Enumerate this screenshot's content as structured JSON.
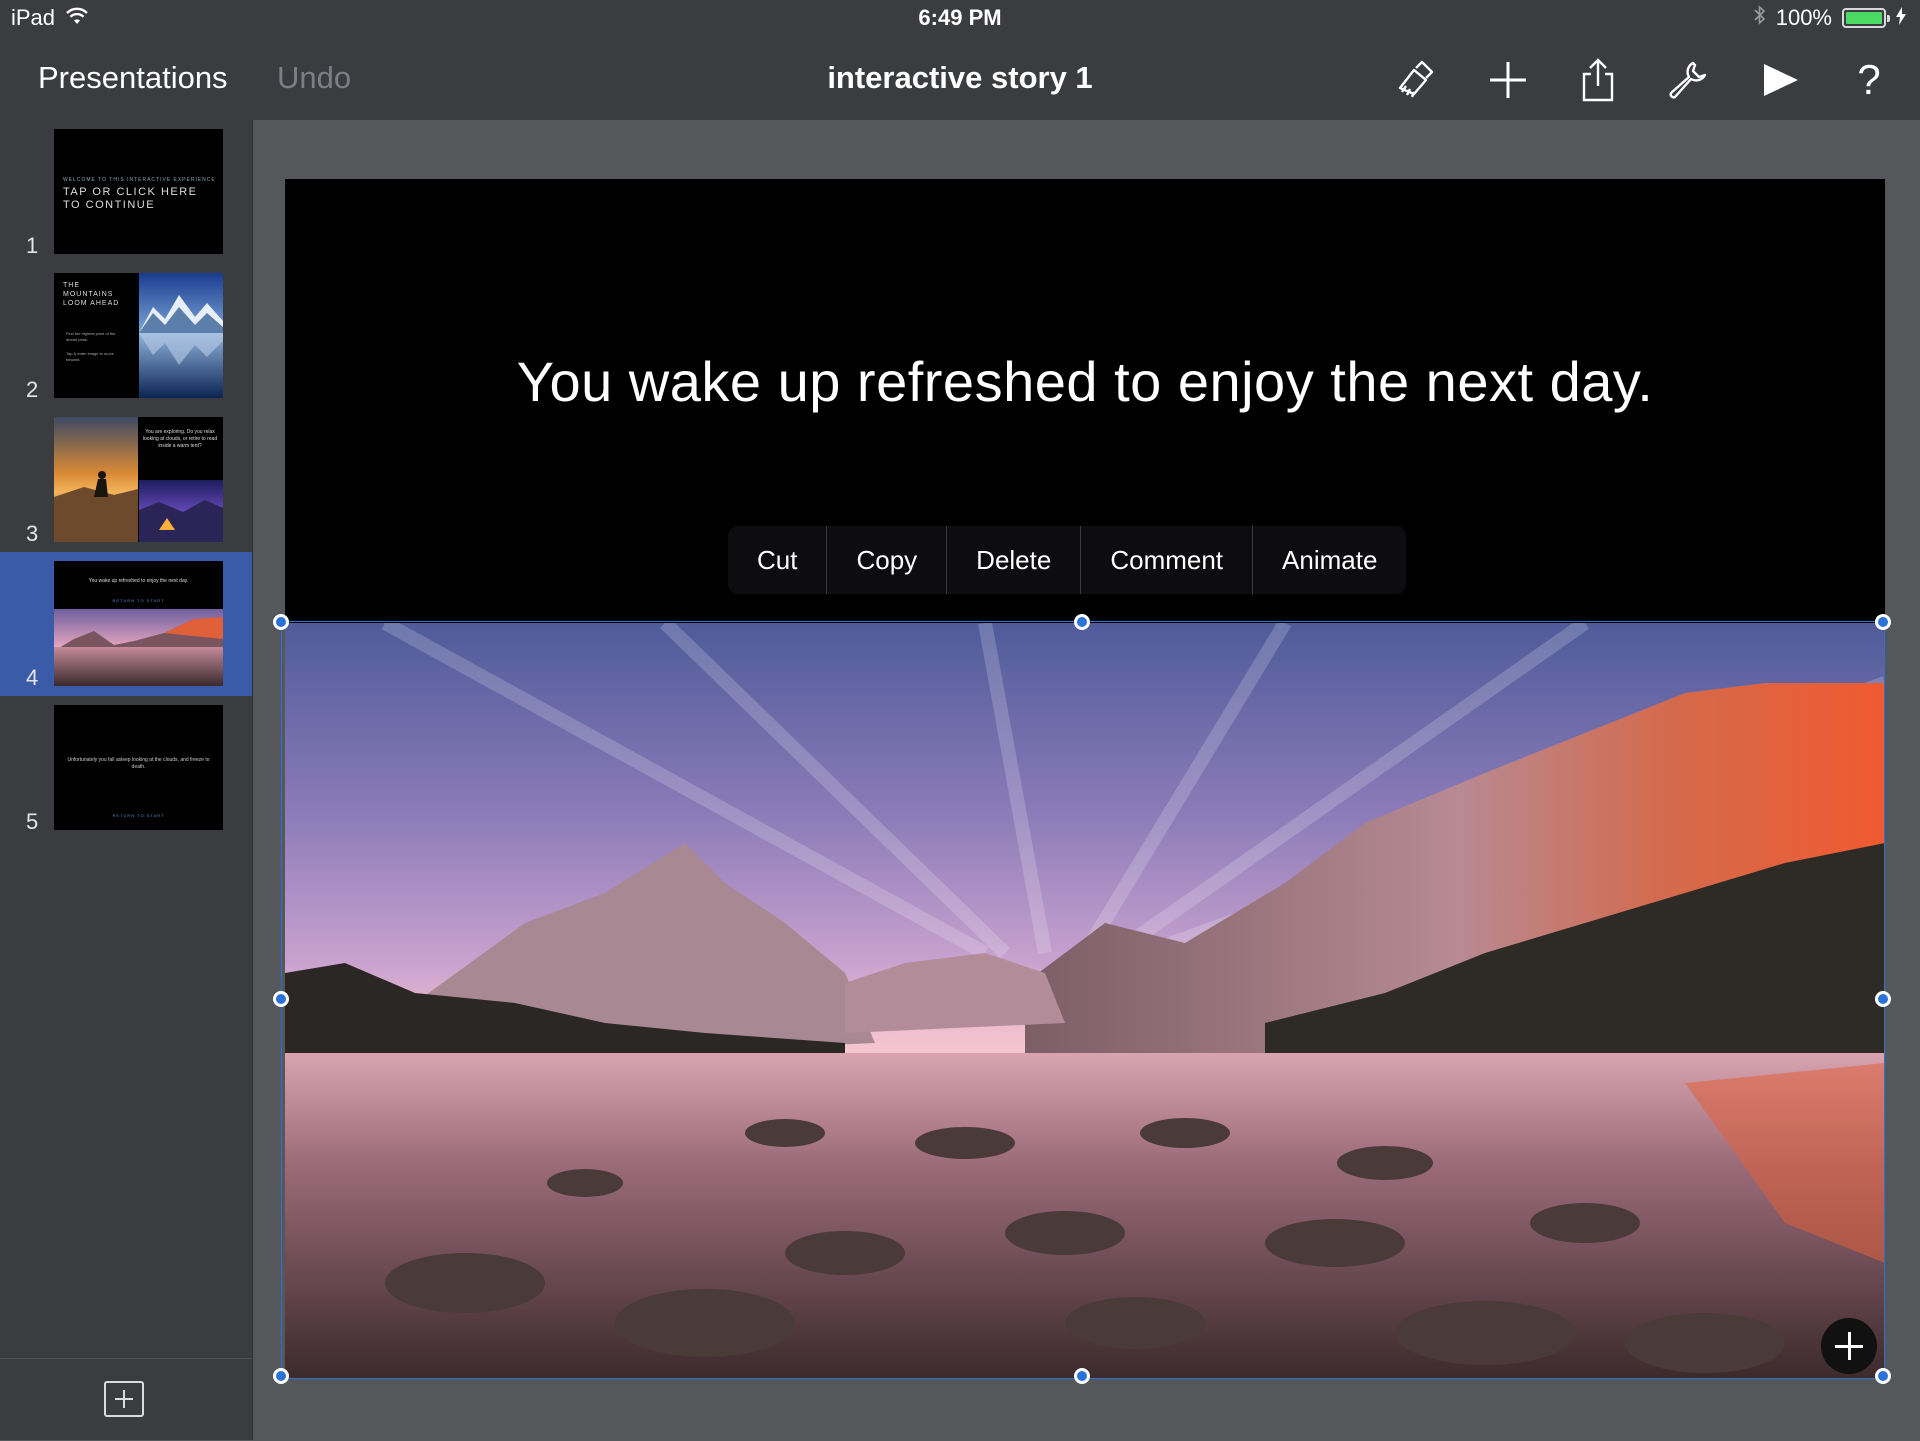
{
  "status_bar": {
    "device": "iPad",
    "time": "6:49 PM",
    "battery": "100%",
    "battery_level": 1.0
  },
  "toolbar": {
    "presentations_label": "Presentations",
    "undo_label": "Undo",
    "title": "interactive story 1",
    "icons": [
      "format-brush-icon",
      "plus-icon",
      "share-icon",
      "wrench-icon",
      "play-icon",
      "help-icon"
    ],
    "help_glyph": "?"
  },
  "slides": [
    {
      "number": "1",
      "lines": [
        "WELCOME TO THIS INTERACTIVE EXPERIENCE",
        "TAP OR CLICK HERE TO CONTINUE"
      ]
    },
    {
      "number": "2",
      "lines": [
        "THE MOUNTAINS LOOM AHEAD",
        "Find the highest point of the ahead peak.",
        "Tap & enter image to move forward."
      ]
    },
    {
      "number": "3",
      "lines": [
        "You are exploring. Do you relax looking at clouds, or retire to read inside a warm tent?"
      ]
    },
    {
      "number": "4",
      "lines": [
        "You wake up refreshed to enjoy the next day.",
        "RETURN TO START"
      ]
    },
    {
      "number": "5",
      "lines": [
        "Unfortunately you fall asleep looking at the clouds, and freeze to death.",
        "RETURN TO START"
      ]
    }
  ],
  "selected_slide": 4,
  "slide": {
    "text": "You wake up refreshed to enjoy the next day."
  },
  "context_menu": {
    "items": [
      "Cut",
      "Copy",
      "Delete",
      "Comment",
      "Animate"
    ]
  },
  "colors": {
    "toolbar_bg": "#3b3c40",
    "canvas_bg": "#56575b",
    "selection": "#2a72d8",
    "selected_thumb_bg": "#3a5ca8",
    "battery": "#4cd964"
  }
}
